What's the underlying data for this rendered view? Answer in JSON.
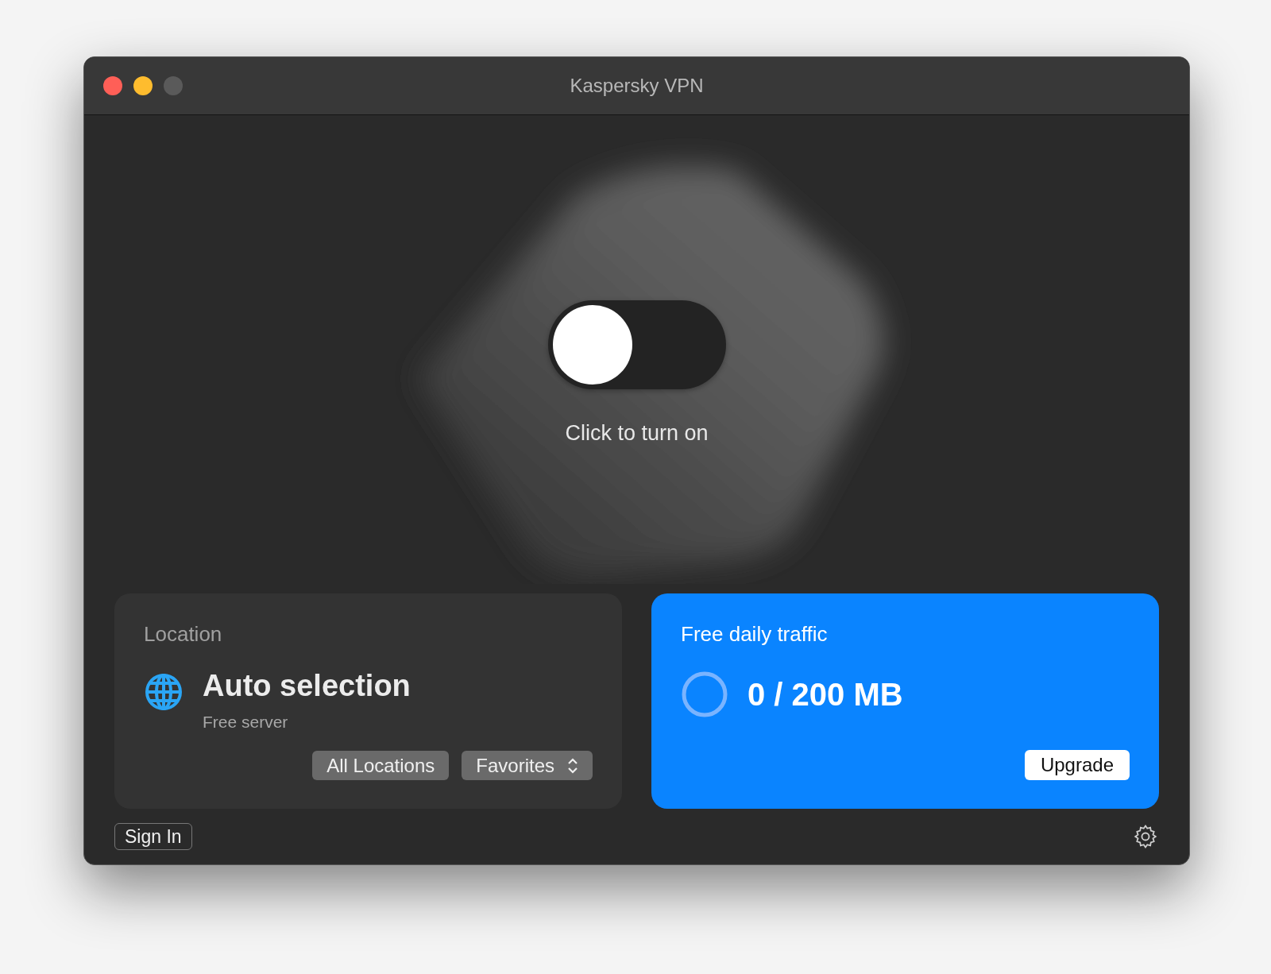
{
  "window": {
    "title": "Kaspersky VPN"
  },
  "power": {
    "on": false,
    "caption": "Click to turn on"
  },
  "location": {
    "heading": "Location",
    "server_name": "Auto selection",
    "server_type": "Free server",
    "buttons": [
      {
        "label": "All Locations",
        "kind": "plain"
      },
      {
        "label": "Favorites",
        "kind": "popup"
      }
    ]
  },
  "traffic": {
    "heading": "Free daily traffic",
    "reading": "0 / 200 MB",
    "button": "Upgrade"
  },
  "footer": {
    "sign_in": "Sign In"
  }
}
